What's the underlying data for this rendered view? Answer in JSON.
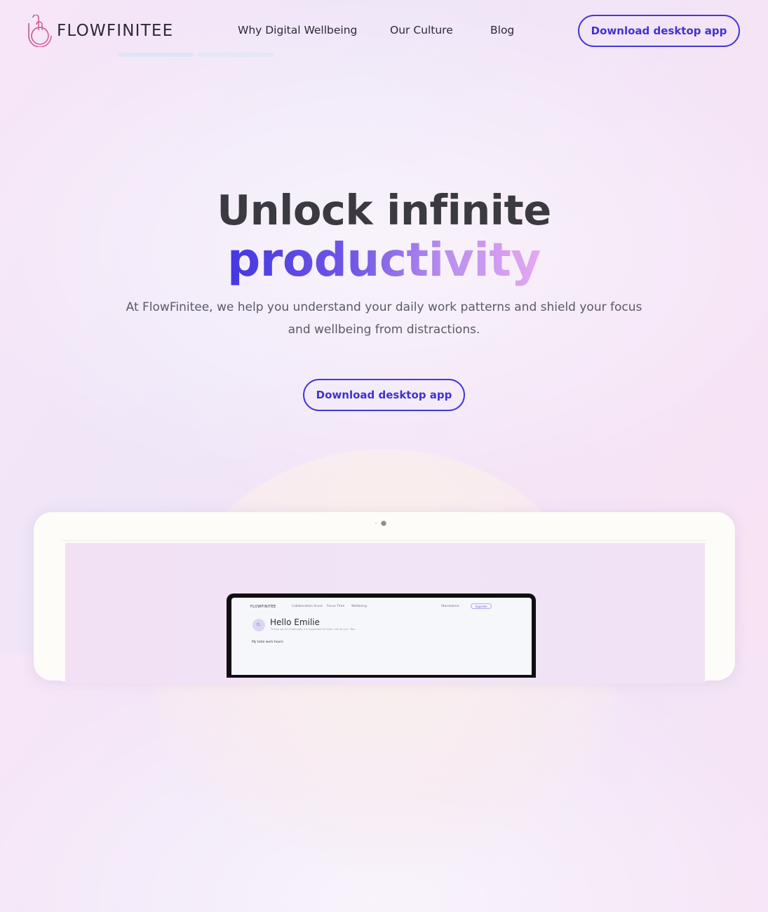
{
  "brand": {
    "name": "FLOWFINITEE"
  },
  "nav": {
    "items": [
      "Why Digital Wellbeing",
      "Our Culture",
      "Blog"
    ],
    "cta": "Download desktop app"
  },
  "hero": {
    "title_line1": "Unlock infinite",
    "title_line2": "productivity",
    "subtitle": "At FlowFinitee, we help you understand your daily work patterns and shield your focus and wellbeing from distractions.",
    "cta": "Download desktop app"
  },
  "app_preview": {
    "logo": "FLOWFINITEE",
    "nav": [
      "Collaboration Score",
      "Focus Time",
      "Wellbeing"
    ],
    "scope": "Standalone",
    "upgrade": "Upgrade",
    "avatar": "EL",
    "greeting": "Hello Emilie",
    "quote": "\"If they say it's impossible, it's impossible for them, not for you.\" Bob",
    "total_label": "My total work hours"
  },
  "colors": {
    "accent": "#4338d6",
    "gradient_start": "#4338e0",
    "gradient_end": "#e6a8f1"
  }
}
